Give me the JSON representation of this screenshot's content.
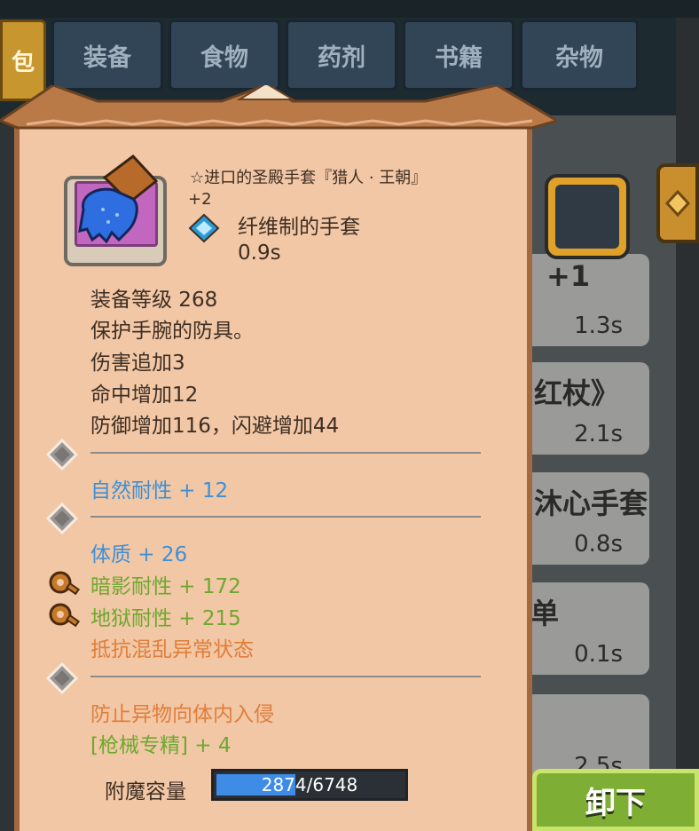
{
  "tabs": {
    "active_label": "包",
    "items": [
      "装备",
      "食物",
      "药剂",
      "书籍",
      "杂物"
    ]
  },
  "item": {
    "name": "☆进口的圣殿手套『猎人 · 王朝』",
    "plus": "+2",
    "type": "纤维制的手套",
    "time": "0.9s",
    "stats": [
      "装备等级 268",
      "保护手腕的防具。",
      "伤害追加3",
      "命中增加12",
      "防御增加116，闪避增加44"
    ],
    "sockets": [
      {
        "lines": [
          "自然耐性 + 12"
        ]
      },
      {
        "lines": [
          "体质 + 26",
          "暗影耐性 + 172",
          "地狱耐性 + 215",
          "抵抗混乱异常状态"
        ]
      },
      {
        "lines": [
          "防止异物向体内入侵",
          "[枪械专精] + 4"
        ]
      }
    ],
    "enchant": {
      "label": "附魔容量",
      "value_text": "2874/6748",
      "fraction": 0.426
    }
  },
  "behind_list": [
    {
      "name": "+1",
      "time": "1.3s"
    },
    {
      "name": "红杖》",
      "time": "2.1s"
    },
    {
      "name": "沐心手套",
      "time": "0.8s"
    },
    {
      "name": "单",
      "time": "0.1s"
    },
    {
      "name": "",
      "time": "2.5s"
    }
  ],
  "unequip_label": "卸下",
  "colors": {
    "card_bg": "#f1c7a6",
    "blue_stat": "#3e8fd6",
    "green_stat": "#6ea82e",
    "orange_stat": "#e07e3a",
    "enchant_bar": "#3f8ce6"
  },
  "icons": {
    "item_icon": "blue-glove-icon",
    "type_icon": "blue-gem-icon",
    "socket_icon": "gray-diamond-socket-icon",
    "gear_icon": "bronze-gear-icon"
  }
}
